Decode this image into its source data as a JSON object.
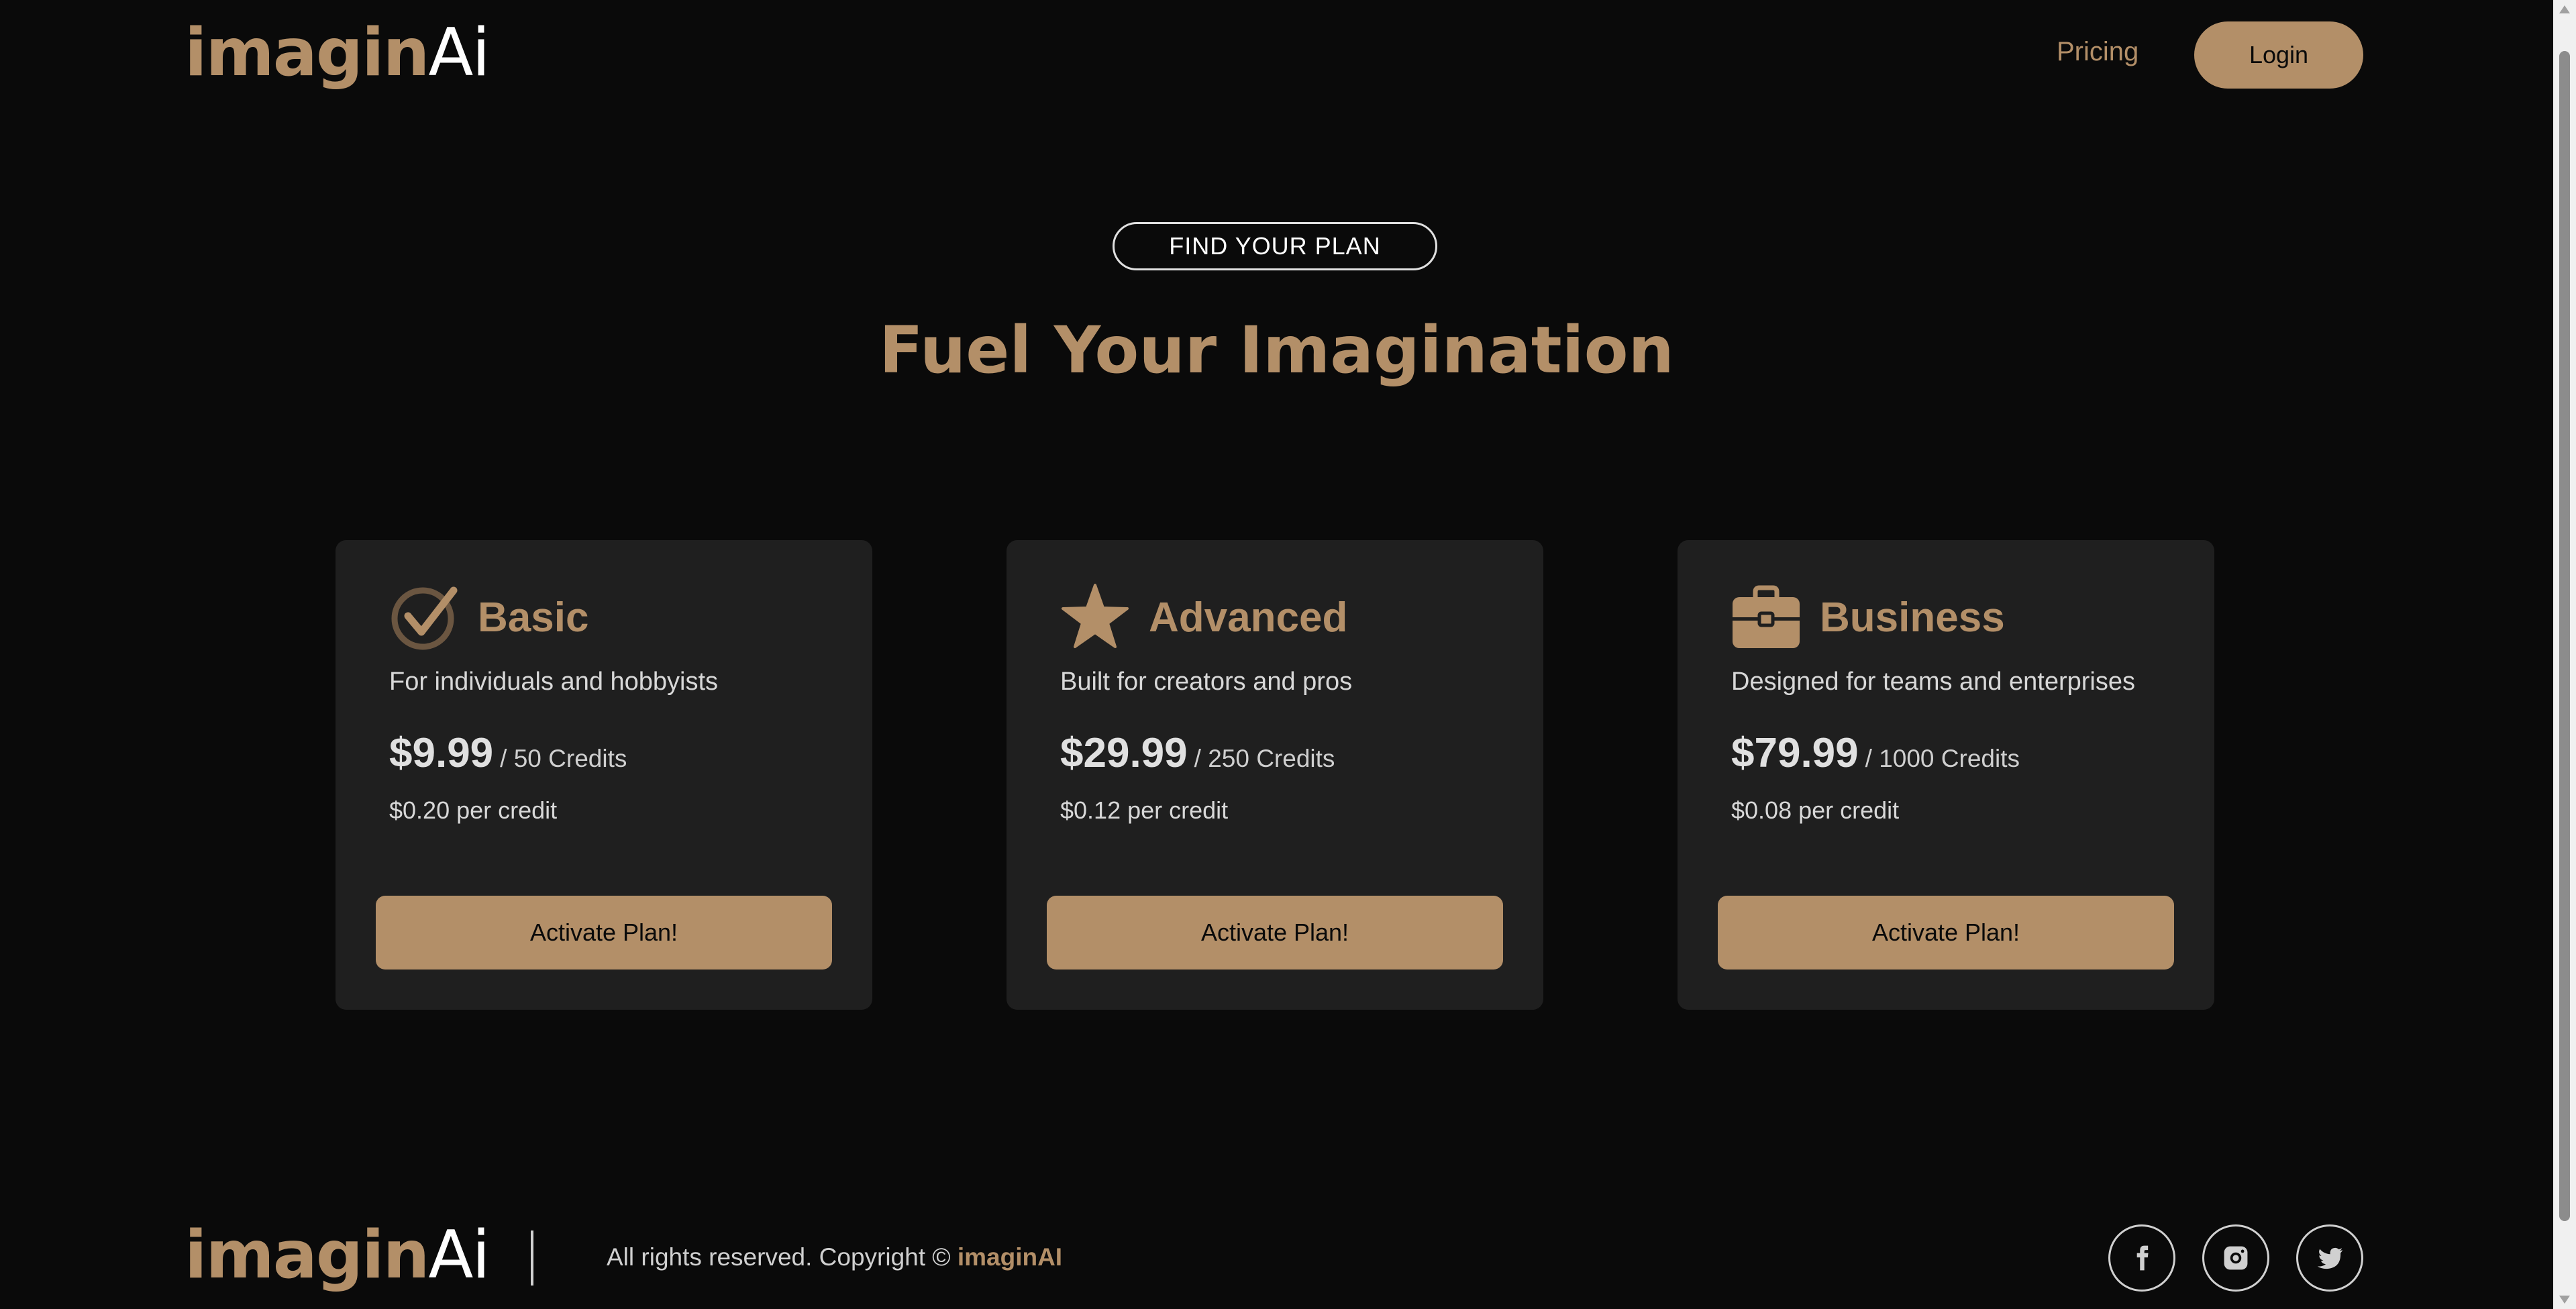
{
  "header": {
    "logo_main": "imagin",
    "logo_ai": "Ai",
    "nav_pricing": "Pricing",
    "login_label": "Login"
  },
  "hero": {
    "eyebrow": "FIND YOUR PLAN",
    "headline": "Fuel Your Imagination"
  },
  "plans": [
    {
      "icon": "check-circle-icon",
      "title": "Basic",
      "desc": "For individuals and hobbyists",
      "price": "$9.99",
      "credits": "/ 50 Credits",
      "rate": "$0.20 per credit",
      "cta": "Activate Plan!"
    },
    {
      "icon": "star-icon",
      "title": "Advanced",
      "desc": "Built for creators and pros",
      "price": "$29.99",
      "credits": "/ 250 Credits",
      "rate": "$0.12 per credit",
      "cta": "Activate Plan!"
    },
    {
      "icon": "briefcase-icon",
      "title": "Business",
      "desc": "Designed for teams and enterprises",
      "price": "$79.99",
      "credits": "/ 1000 Credits",
      "rate": "$0.08 per credit",
      "cta": "Activate Plan!"
    }
  ],
  "footer": {
    "logo_main": "imagin",
    "logo_ai": "Ai",
    "copyright_text": "All rights reserved. Copyright © ",
    "copyright_brand": "imaginAI",
    "social": [
      "facebook-icon",
      "instagram-icon",
      "twitter-icon"
    ]
  },
  "colors": {
    "background": "#0a0a0a",
    "accent": "#b38f68",
    "card": "#1f1f1f",
    "text": "#d8d8d8"
  }
}
